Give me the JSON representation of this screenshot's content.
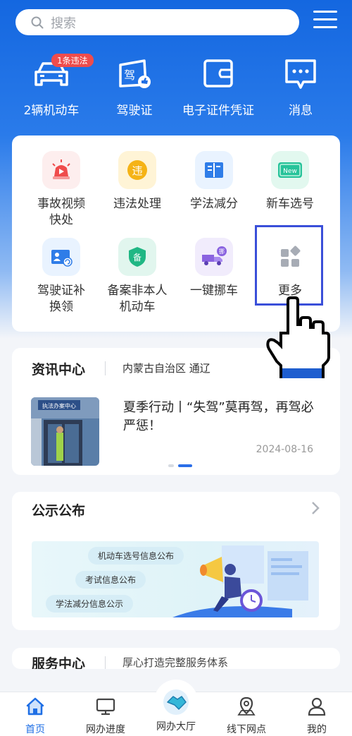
{
  "search": {
    "placeholder": "搜索"
  },
  "quick_links": [
    {
      "label": "2辆机动车",
      "icon": "car-icon",
      "badge": "1条违法"
    },
    {
      "label": "驾驶证",
      "icon": "license-icon",
      "badge_text": "驾"
    },
    {
      "label": "电子证件凭证",
      "icon": "wallet-icon"
    },
    {
      "label": "消息",
      "icon": "message-icon"
    }
  ],
  "services": [
    {
      "label": "事故视频快处",
      "icon": "siren-icon",
      "color": "#ef4b4b"
    },
    {
      "label": "违法处理",
      "icon": "violation-icon",
      "glyph": "违",
      "color": "#f5b316"
    },
    {
      "label": "学法减分",
      "icon": "book-icon",
      "color": "#2f7de8"
    },
    {
      "label": "新车选号",
      "icon": "new-plate-icon",
      "glyph": "New",
      "color": "#27c39a"
    },
    {
      "label": "驾驶证补换领",
      "icon": "id-card-icon",
      "color": "#2f7de8"
    },
    {
      "label": "备案非本人机动车",
      "icon": "shield-icon",
      "glyph": "备",
      "color": "#20b784"
    },
    {
      "label": "一键挪车",
      "icon": "tow-truck-icon",
      "glyph": "挪",
      "color": "#8a63e0"
    },
    {
      "label": "更多",
      "icon": "more-grid-icon",
      "color": "#9aa0aa"
    }
  ],
  "news": {
    "title": "资讯中心",
    "region": "内蒙古自治区 通辽",
    "headline": "夏季行动丨“失驾”莫再驾，再驾必严惩！",
    "date": "2024-08-16",
    "image_sign": "执法办案中心"
  },
  "publish": {
    "title": "公示公布",
    "items": [
      "机动车选号信息公布",
      "考试信息公布",
      "学法减分信息公示"
    ]
  },
  "service_center": {
    "title": "服务中心",
    "subtitle": "厚心打造完整服务体系"
  },
  "tabs": [
    {
      "label": "首页",
      "icon": "home-icon",
      "active": true
    },
    {
      "label": "网办进度",
      "icon": "monitor-icon",
      "active": false
    },
    {
      "label": "网办大厅",
      "icon": "handshake-icon",
      "active": false
    },
    {
      "label": "线下网点",
      "icon": "location-icon",
      "active": false
    },
    {
      "label": "我的",
      "icon": "user-icon",
      "active": false
    }
  ],
  "colors": {
    "primary": "#1f6fe5",
    "accent_red": "#ee4c4c"
  }
}
